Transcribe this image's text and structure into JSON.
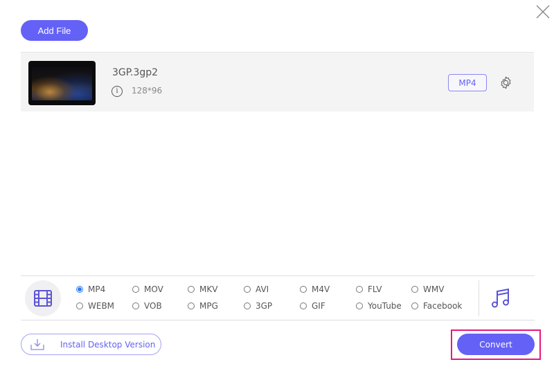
{
  "window": {
    "close_icon": "close-icon"
  },
  "toolbar": {
    "add_file_label": "Add File"
  },
  "file": {
    "name": "3GP.3gp2",
    "resolution": "128*96",
    "info_icon_glyph": "i",
    "output_format": "MP4"
  },
  "formats": {
    "selected": "MP4",
    "video_options": [
      [
        "MP4",
        "MOV",
        "MKV",
        "AVI",
        "M4V",
        "FLV",
        "WMV"
      ],
      [
        "WEBM",
        "VOB",
        "MPG",
        "3GP",
        "GIF",
        "YouTube",
        "Facebook"
      ]
    ]
  },
  "footer": {
    "install_label": "Install Desktop Version",
    "convert_label": "Convert"
  },
  "colors": {
    "accent": "#6461f7",
    "highlight": "#e8157f",
    "radio_selected": "#2f7bf5"
  }
}
